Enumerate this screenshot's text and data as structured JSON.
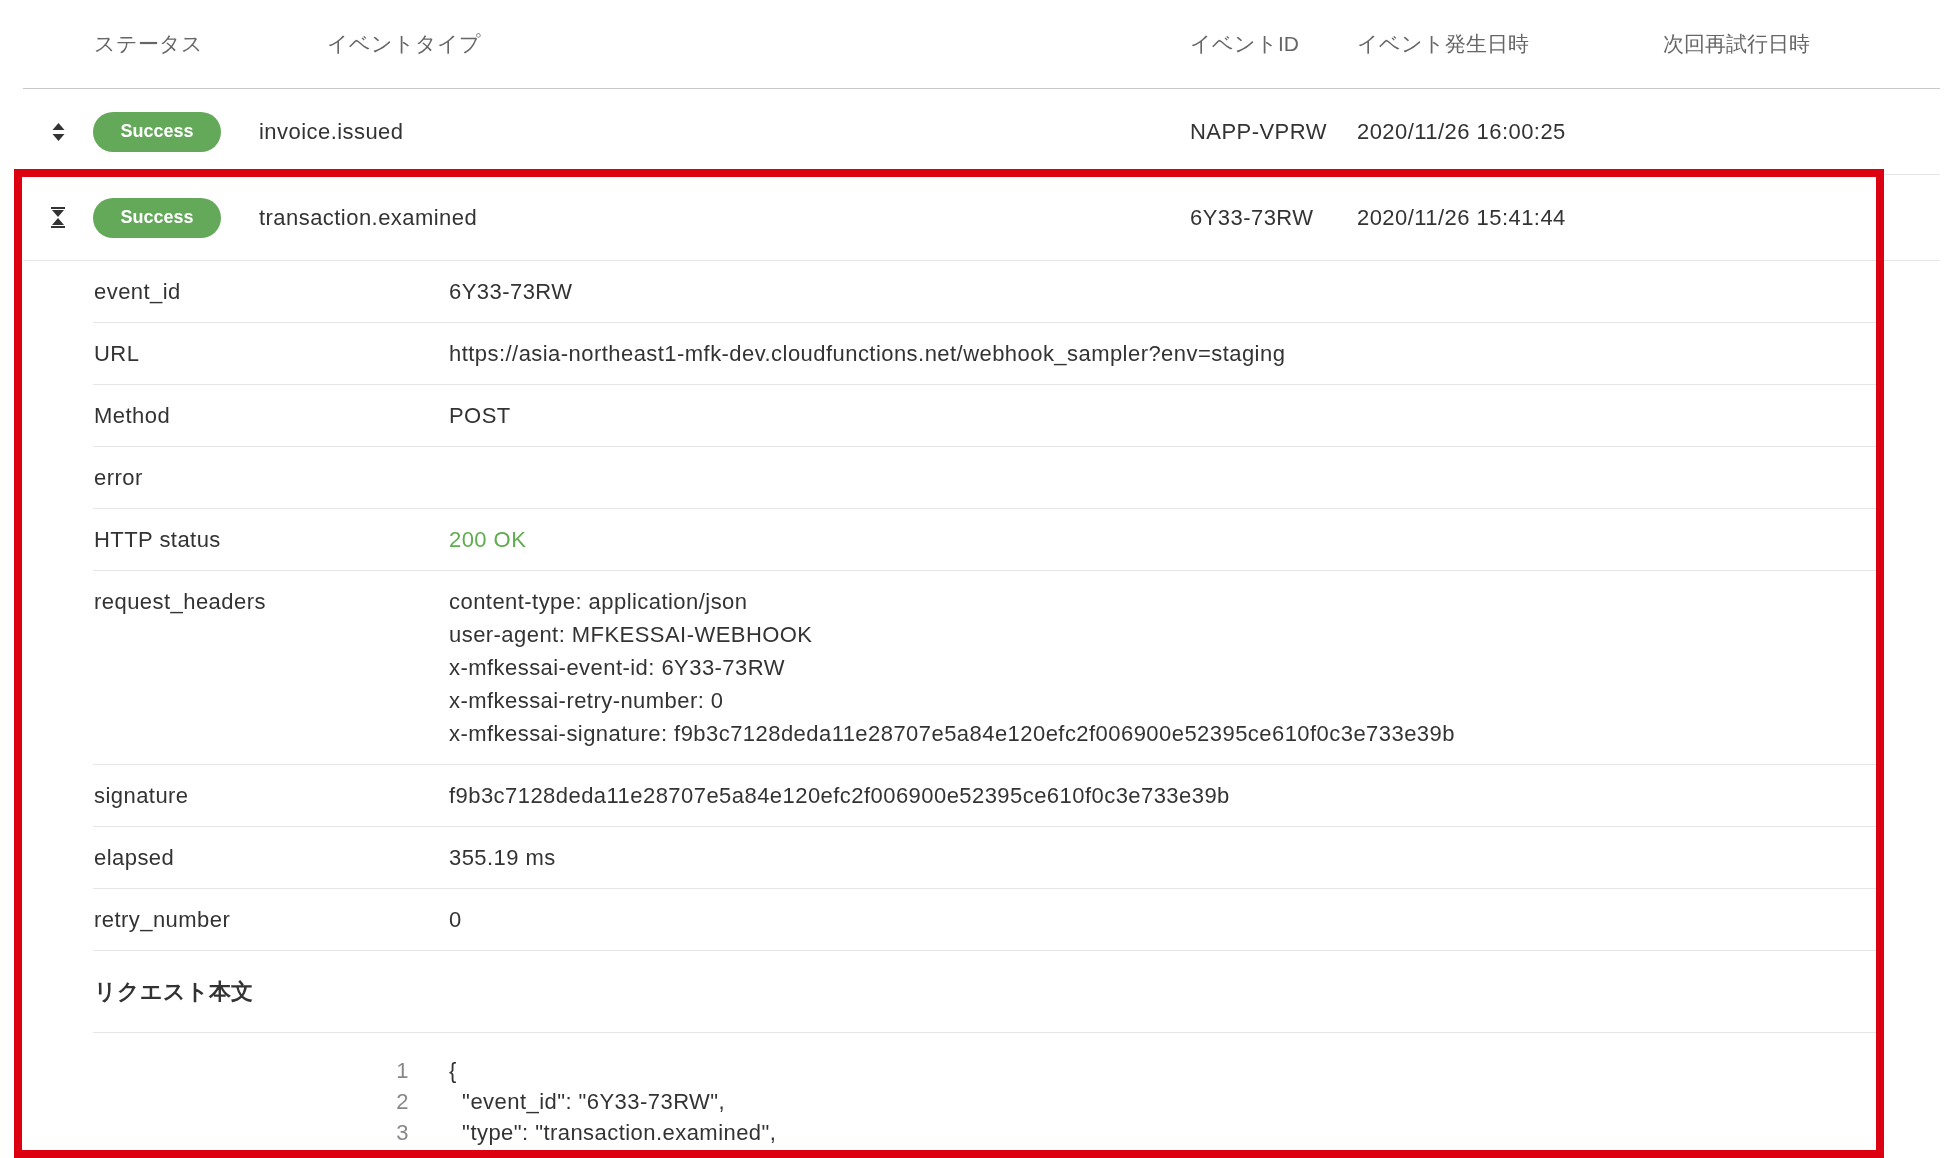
{
  "table": {
    "columns": [
      "ステータス",
      "イベントタイプ",
      "イベントID",
      "イベント発生日時",
      "次回再試行日時"
    ],
    "rows": [
      {
        "expanded": false,
        "highlighted": false,
        "status": "Success",
        "event_type": "invoice.issued",
        "event_id": "NAPP-VPRW",
        "occurred_at": "2020/11/26 16:00:25"
      },
      {
        "expanded": true,
        "highlighted": true,
        "status": "Success",
        "event_type": "transaction.examined",
        "event_id": "6Y33-73RW",
        "occurred_at": "2020/11/26 15:41:44",
        "details": {
          "fields": [
            {
              "label": "event_id",
              "value": "6Y33-73RW"
            },
            {
              "label": "URL",
              "value": "https://asia-northeast1-mfk-dev.cloudfunctions.net/webhook_sampler?env=staging"
            },
            {
              "label": "Method",
              "value": "POST"
            },
            {
              "label": "error"
            },
            {
              "label": "HTTP status",
              "value": "200 OK",
              "color": "#5fad4e"
            },
            {
              "label": "request_headers",
              "lines": [
                "content-type: application/json",
                "user-agent: MFKESSAI-WEBHOOK",
                "x-mfkessai-event-id: 6Y33-73RW",
                "x-mfkessai-retry-number: 0",
                "x-mfkessai-signature: f9b3c7128deda11e28707e5a84e120efc2f006900e52395ce610f0c3e733e39b"
              ]
            },
            {
              "label": "signature",
              "value": "f9b3c7128deda11e28707e5a84e120efc2f006900e52395ce610f0c3e733e39b"
            },
            {
              "label": "elapsed",
              "value": "355.19 ms"
            },
            {
              "label": "retry_number",
              "value": "0"
            }
          ],
          "request_body": {
            "title": "リクエスト本文",
            "lines": [
              {
                "number": "1",
                "text": "{"
              },
              {
                "number": "2",
                "text": "  \"event_id\": \"6Y33-73RW\","
              },
              {
                "number": "3",
                "text": "  \"type\": \"transaction.examined\","
              }
            ]
          }
        }
      }
    ]
  }
}
